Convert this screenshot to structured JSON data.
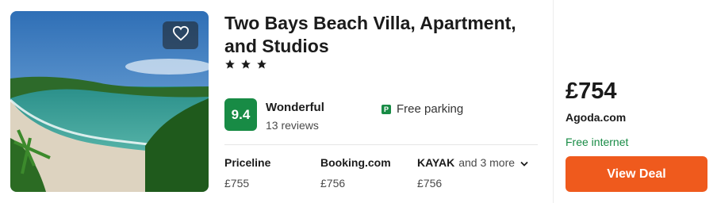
{
  "hotel": {
    "name": "Two Bays Beach Villa, Apartment, and Studios",
    "stars": 3,
    "rating_score": "9.4",
    "rating_word": "Wonderful",
    "reviews": "13 reviews",
    "amenity_icon_letter": "P",
    "amenity": "Free parking"
  },
  "providers": [
    {
      "name": "Priceline",
      "price": "£755"
    },
    {
      "name": "Booking.com",
      "price": "£756"
    },
    {
      "name": "KAYAK",
      "more": "and 3 more",
      "price": "£756"
    }
  ],
  "deal": {
    "price": "£754",
    "provider": "Agoda.com",
    "perk": "Free internet",
    "button_label": "View Deal"
  },
  "colors": {
    "rating_green": "#188b45",
    "deal_orange": "#ef5a1d"
  },
  "icons": [
    "heart-icon",
    "star-icon",
    "parking-icon",
    "chevron-down-icon"
  ]
}
